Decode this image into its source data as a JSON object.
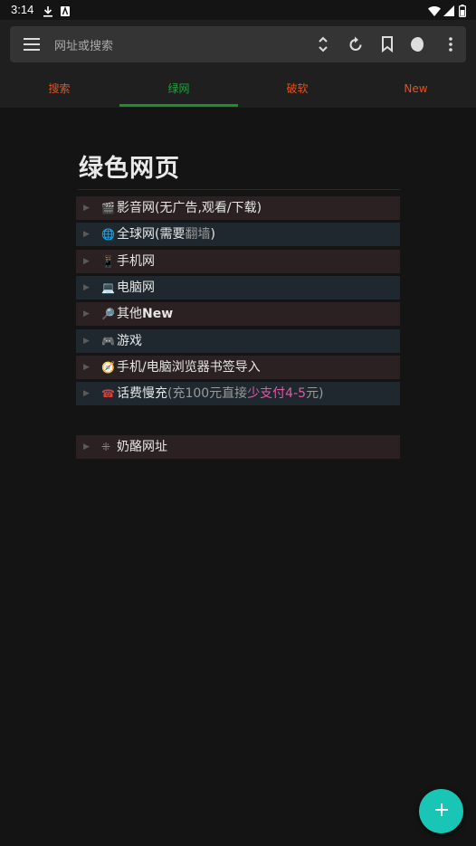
{
  "status_bar": {
    "time": "3:14"
  },
  "address_bar": {
    "placeholder": "网址或搜索"
  },
  "tabs": [
    {
      "label": "搜索",
      "color": "#e0541f"
    },
    {
      "label": "绿网",
      "color": "#1ca33a"
    },
    {
      "label": "破软",
      "color": "#e0541f"
    },
    {
      "label": "New",
      "color": "#e0541f"
    }
  ],
  "page": {
    "title": "绿色网页",
    "items": [
      {
        "emoji": "🎬",
        "text": "影音网(无广告,观看/下载)"
      },
      {
        "emoji": "🌐",
        "text_a": "全球网(需要",
        "text_b": "翻墙",
        "text_c": ")"
      },
      {
        "emoji": "📱",
        "text": "手机网"
      },
      {
        "emoji": "💻",
        "text": "电脑网"
      },
      {
        "emoji": "🔎",
        "text_a": "其他",
        "text_b": "New"
      },
      {
        "emoji": "🎮",
        "text": "游戏"
      },
      {
        "emoji": "🧭",
        "text": "手机/电脑浏览器书签导入"
      },
      {
        "emoji": "☎",
        "text_a": "话费慢充",
        "text_b": "(充100元直接",
        "text_c": "少支付4-5",
        "text_d": "元)"
      },
      {
        "emoji": "⁜",
        "text": "奶酪网址"
      }
    ]
  },
  "fab": {
    "icon": "plus-icon",
    "color": "#19c6b5"
  }
}
